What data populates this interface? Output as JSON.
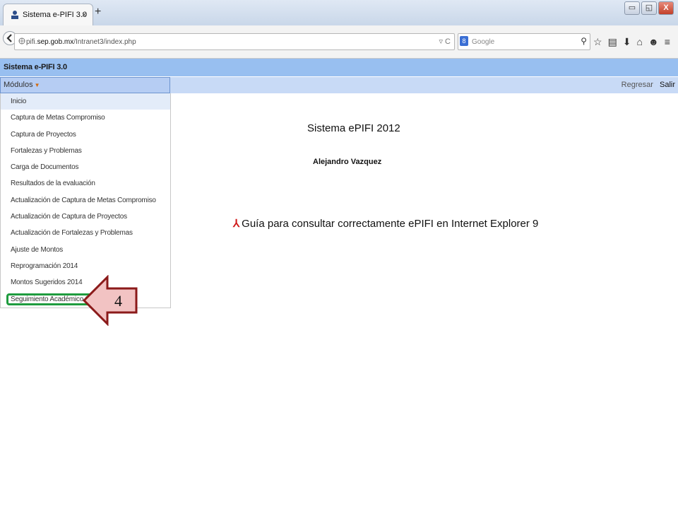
{
  "browser": {
    "tab_title": "Sistema e-PIFI 3.0",
    "tab_close": "×",
    "new_tab": "+",
    "url_prefix": "pifi.",
    "url_domain": "sep.gob.mx",
    "url_path": "/Intranet3/index.php",
    "search_placeholder": "Google",
    "window_buttons": [
      "▭",
      "◱",
      "X"
    ]
  },
  "app": {
    "title": "Sistema e-PIFI 3.0",
    "modules_label": "Módulos",
    "regresar": "Regresar",
    "salir": "Salir"
  },
  "menu": {
    "items": [
      "Inicio",
      "Captura de Metas Compromiso",
      "Captura de Proyectos",
      "Fortalezas y Problemas",
      "Carga de Documentos",
      "Resultados de la evaluación",
      "Actualización de Captura de Metas Compromiso",
      "Actualización de Captura de Proyectos",
      "Actualización de Fortalezas y Problemas",
      "Ajuste de Montos",
      "Reprogramación 2014",
      "Montos Sugeridos 2014",
      "Seguimiento Académico 2014"
    ]
  },
  "main": {
    "heading": "Sistema ePIFI 2012",
    "author": "Alejandro Vazquez",
    "guide_link": "Guía para consultar correctamente ePIFI en Internet Explorer 9"
  },
  "annotation": {
    "step_number": "4",
    "arrow_color": "#f2c3c3",
    "arrow_border": "#8b1a1a",
    "highlight_color": "#1f9c3f"
  }
}
